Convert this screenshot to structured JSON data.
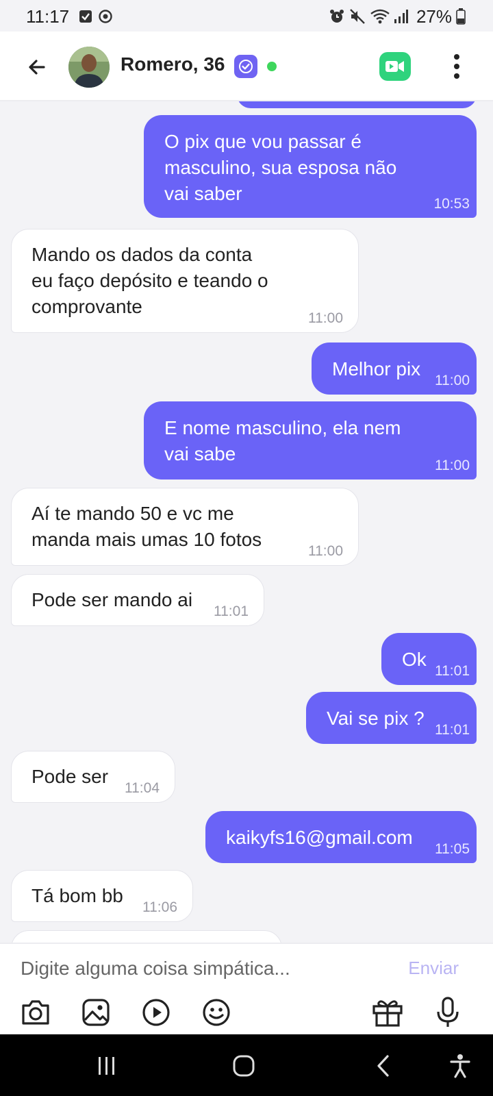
{
  "status_bar": {
    "time": "11:17",
    "battery": "27%",
    "left_icons": [
      "message-notification-icon",
      "sync-notification-icon"
    ],
    "right_icons": [
      "alarm-icon",
      "mute-icon",
      "wifi-icon",
      "signal-icon",
      "battery-icon"
    ]
  },
  "header": {
    "contact_name": "Romero, 36",
    "verified": true,
    "online": true,
    "online_color": "#3ed65c",
    "accent_color": "#6a63f7",
    "video_color": "#2fd37d"
  },
  "messages": [
    {
      "direction": "sent",
      "text": "O pix que vou passar é\nmasculino, sua esposa não\nvai saber",
      "time": "10:53"
    },
    {
      "direction": "received",
      "text": "Mando os dados da conta\neu faço depósito e teando o\ncomprovante",
      "time": "11:00"
    },
    {
      "direction": "sent",
      "text": "Melhor pix",
      "time": "11:00"
    },
    {
      "direction": "sent",
      "text": "E nome masculino, ela nem\nvai sabe",
      "time": "11:00"
    },
    {
      "direction": "received",
      "text": "Aí te mando 50 e vc me\nmanda mais umas 10 fotos",
      "time": "11:00"
    },
    {
      "direction": "received",
      "text": "Pode ser mando ai",
      "time": "11:01"
    },
    {
      "direction": "sent",
      "text": "Ok",
      "time": "11:01"
    },
    {
      "direction": "sent",
      "text": "Vai se pix ?",
      "time": "11:01"
    },
    {
      "direction": "received",
      "text": "Pode ser",
      "time": "11:04"
    },
    {
      "direction": "sent",
      "text": "kaikyfs16@gmail.com",
      "time": "11:05"
    },
    {
      "direction": "received",
      "text": "Tá bom bb",
      "time": "11:06"
    }
  ],
  "composer": {
    "placeholder": "Digite alguma coisa simpática...",
    "send_label": "Enviar",
    "tools": [
      "camera-icon",
      "gallery-icon",
      "video-play-icon",
      "emoji-icon",
      "gift-icon",
      "microphone-icon"
    ]
  },
  "nav_bar": {
    "buttons": [
      "recent-apps-icon",
      "home-icon",
      "back-icon",
      "accessibility-icon"
    ]
  }
}
